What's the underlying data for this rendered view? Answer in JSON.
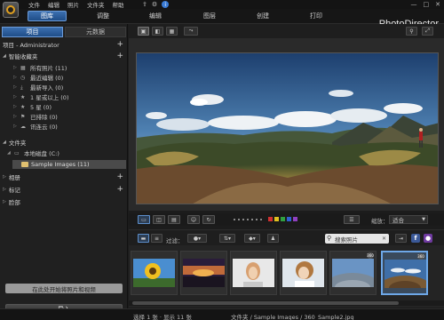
{
  "menu": {
    "items": [
      "文件",
      "编辑",
      "照片",
      "文件夹",
      "帮助"
    ]
  },
  "window_controls": [
    "—",
    "□",
    "✕"
  ],
  "modules": {
    "tabs": [
      "图库",
      "调整",
      "编辑",
      "图层",
      "创建",
      "打印"
    ],
    "active": "图库"
  },
  "brand": "PhotoDirector",
  "left_panel": {
    "tabs": [
      "项目",
      "元数据"
    ],
    "active_tab": "项目",
    "project_header": "项目 - Administrator",
    "smart_collections": {
      "label": "智能收藏夹",
      "items": [
        {
          "label": "所有照片 (11)",
          "icon": "grid-icon"
        },
        {
          "label": "最近编辑 (0)",
          "icon": "clock-icon"
        },
        {
          "label": "最新导入 (0)",
          "icon": "import-icon"
        },
        {
          "label": "1 星或以上 (0)",
          "icon": "star-icon"
        },
        {
          "label": "5 星 (0)",
          "icon": "star-icon"
        },
        {
          "label": "已排除 (0)",
          "icon": "flag-icon"
        },
        {
          "label": "讯连云 (0)",
          "icon": "cloud-icon"
        }
      ]
    },
    "folders": {
      "label": "文件夹",
      "drive": "本地磁盘 (C:)",
      "selected_folder": "Sample Images (11)"
    },
    "albums_label": "相册",
    "tags_label": "标记",
    "faces_label": "脸部",
    "tip": "在此处开始将照片和视频",
    "import_button": "导入"
  },
  "view_controls": {
    "zoom_label": "缩放：",
    "zoom_value": "适合",
    "colors": [
      "#d03030",
      "#e0c020",
      "#30a040",
      "#3060d0",
      "#9040c0"
    ]
  },
  "browser_toolbar": {
    "filter_label": "过滤：",
    "search_placeholder": "搜索照片"
  },
  "filmstrip": {
    "thumbnails": [
      {
        "subject": "sunflower",
        "has_360": false,
        "selected": false
      },
      {
        "subject": "sunset",
        "has_360": false,
        "selected": false
      },
      {
        "subject": "portrait-woman",
        "has_360": false,
        "selected": false
      },
      {
        "subject": "portrait-woman-2",
        "has_360": false,
        "selected": false
      },
      {
        "subject": "360-panorama-1",
        "has_360": true,
        "selected": false
      },
      {
        "subject": "360-panorama-2",
        "has_360": true,
        "selected": true
      }
    ],
    "badge_label": "360"
  },
  "status": {
    "selection": "选择 1 张 · 显示 11 张",
    "path": "文件夹 / Sample Images / 360_Sample2.jpg"
  }
}
